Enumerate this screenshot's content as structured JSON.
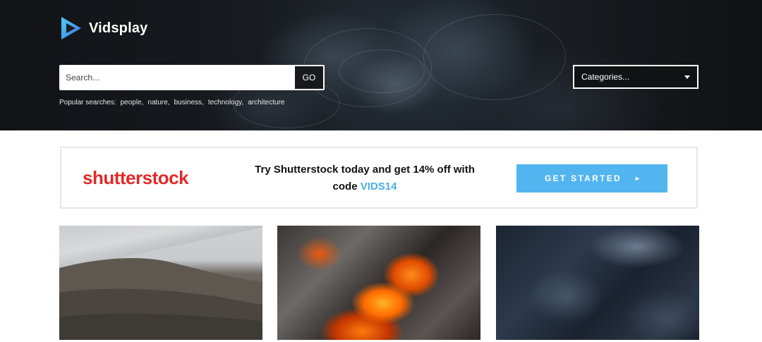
{
  "brand": {
    "name": "Vidsplay",
    "logo_icon": "play-triangle-icon"
  },
  "search": {
    "placeholder": "Search...",
    "button_label": "GO"
  },
  "popular_searches": {
    "label": "Popular searches:",
    "terms": [
      "people,",
      "nature,",
      "business,",
      "technology,",
      "architecture"
    ]
  },
  "categories": {
    "selected": "Categories..."
  },
  "promo": {
    "logo_text": "shutterstock",
    "text_line1": "Try Shutterstock today and get 14% off with",
    "text_line2_prefix": "code",
    "code": "VIDS14",
    "cta_label": "GET STARTED",
    "cta_arrow": "▸",
    "colors": {
      "logo_red": "#e02a2a",
      "cta_blue": "#52b5f0",
      "code_blue": "#4aaee8"
    }
  },
  "thumbnails": [
    {
      "subject": "mountain-landscape"
    },
    {
      "subject": "burning-embers"
    },
    {
      "subject": "dark-blue-rocks"
    }
  ]
}
